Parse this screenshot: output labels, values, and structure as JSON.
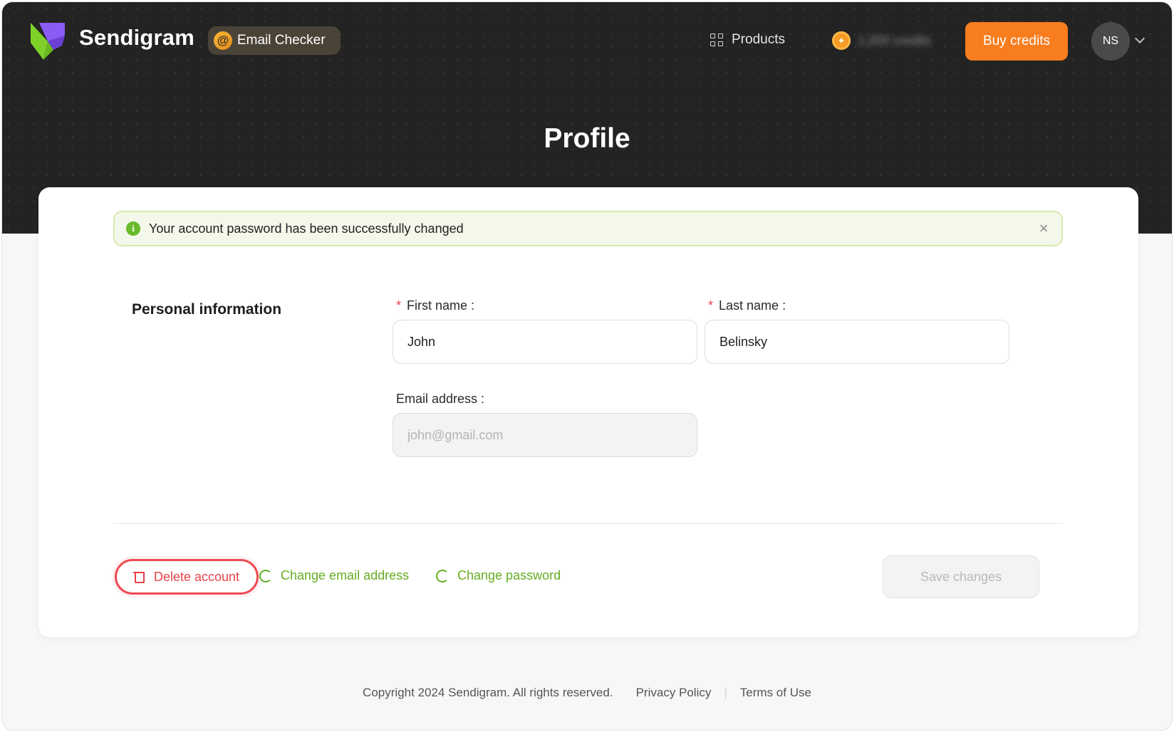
{
  "header": {
    "brand": "Sendigram",
    "product_pill": "Email Checker",
    "products_label": "Products",
    "credits_text": "1,000 credits",
    "buy_credits_label": "Buy credits",
    "avatar_initials": "NS"
  },
  "page": {
    "title": "Profile"
  },
  "alert": {
    "message": "Your account password has been successfully changed"
  },
  "personal_info": {
    "section_title": "Personal information",
    "first_name_label": "First name :",
    "first_name_value": "John",
    "last_name_label": "Last name :",
    "last_name_value": "Belinsky",
    "email_label": "Email address :",
    "email_placeholder": "john@gmail.com",
    "required_mark": "*"
  },
  "actions": {
    "delete_account": "Delete account",
    "change_email": "Change email address",
    "change_password": "Change password",
    "save_changes": "Save changes"
  },
  "footer": {
    "copyright": "Copyright 2024 Sendigram. All rights reserved.",
    "privacy": "Privacy Policy",
    "separator": "|",
    "terms": "Terms of Use"
  },
  "colors": {
    "accent_orange": "#f87d1f",
    "success_green": "#66ad22",
    "danger_red": "#e9424b",
    "hero_dark": "#232323"
  }
}
